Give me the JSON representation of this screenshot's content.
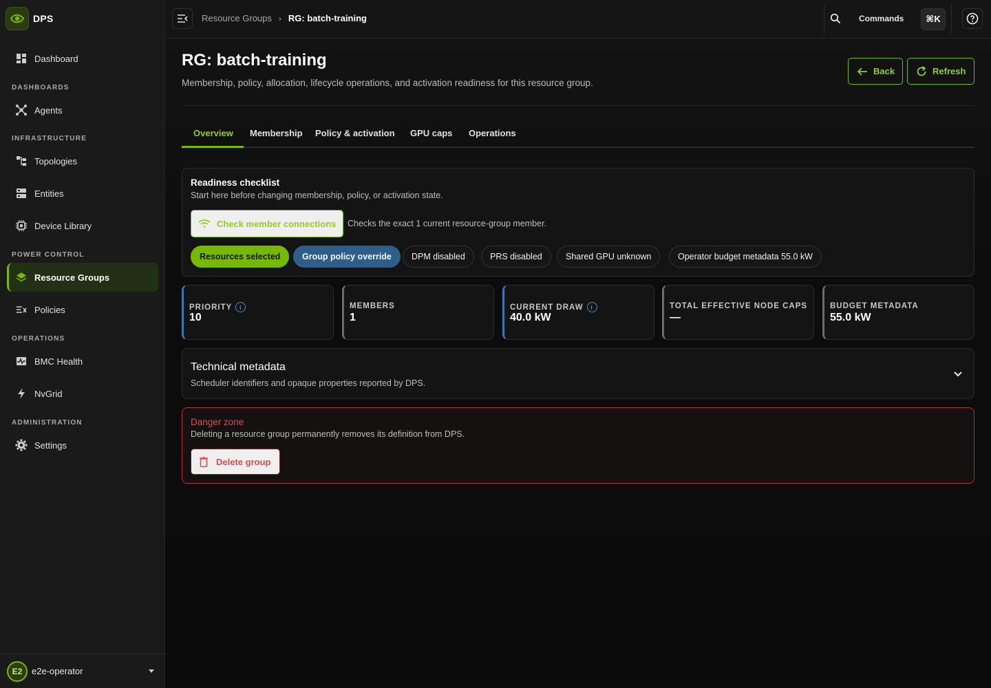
{
  "brand": {
    "name": "DPS"
  },
  "sidebar": {
    "sections": {
      "dashboards": "DASHBOARDS",
      "infrastructure": "INFRASTRUCTURE",
      "power_control": "POWER CONTROL",
      "operations": "OPERATIONS",
      "administration": "ADMINISTRATION"
    },
    "items": {
      "dashboard": "Dashboard",
      "agents": "Agents",
      "topologies": "Topologies",
      "entities": "Entities",
      "device_library": "Device Library",
      "resource_groups": "Resource Groups",
      "policies": "Policies",
      "bmc_health": "BMC Health",
      "nvgrid": "NvGrid",
      "settings": "Settings"
    },
    "active": "resource_groups"
  },
  "user": {
    "avatar": "E2",
    "name": "e2e-operator"
  },
  "topbar": {
    "breadcrumb_parent": "Resource Groups",
    "breadcrumb_sep": "›",
    "breadcrumb_current": "RG: batch-training",
    "commands_label": "Commands",
    "commands_shortcut": "⌘K"
  },
  "page": {
    "title": "RG: batch-training",
    "subtitle": "Membership, policy, allocation, lifecycle operations, and activation readiness for this resource group.",
    "back_label": "Back",
    "refresh_label": "Refresh"
  },
  "tabs": {
    "overview": "Overview",
    "membership": "Membership",
    "policy": "Policy & activation",
    "gpu_caps": "GPU caps",
    "operations": "Operations"
  },
  "readiness": {
    "title": "Readiness checklist",
    "subtitle": "Start here before changing membership, policy, or activation state.",
    "check_label": "Check member connections",
    "check_note": "Checks the exact 1 current resource-group member.",
    "chips": {
      "resources": "Resources selected",
      "policy": "Group policy override",
      "dpm": "DPM disabled",
      "prs": "PRS disabled",
      "shared_gpu": "Shared GPU unknown",
      "budget": "Operator budget metadata 55.0 kW"
    }
  },
  "stats": {
    "priority": {
      "label": "PRIORITY",
      "value": "10"
    },
    "members": {
      "label": "MEMBERS",
      "value": "1"
    },
    "current_draw": {
      "label": "CURRENT DRAW",
      "value": "40.0 kW"
    },
    "node_caps": {
      "label": "TOTAL EFFECTIVE NODE CAPS",
      "value": "—"
    },
    "budget": {
      "label": "BUDGET METADATA",
      "value": "55.0 kW"
    }
  },
  "technical": {
    "title": "Technical metadata",
    "subtitle": "Scheduler identifiers and opaque properties reported by DPS."
  },
  "danger": {
    "title": "Danger zone",
    "subtitle": "Deleting a resource group permanently removes its definition from DPS.",
    "delete_label": "Delete group"
  },
  "colors": {
    "accent": "#76b900",
    "danger": "#e04b4b",
    "info": "#2e5f8a"
  }
}
